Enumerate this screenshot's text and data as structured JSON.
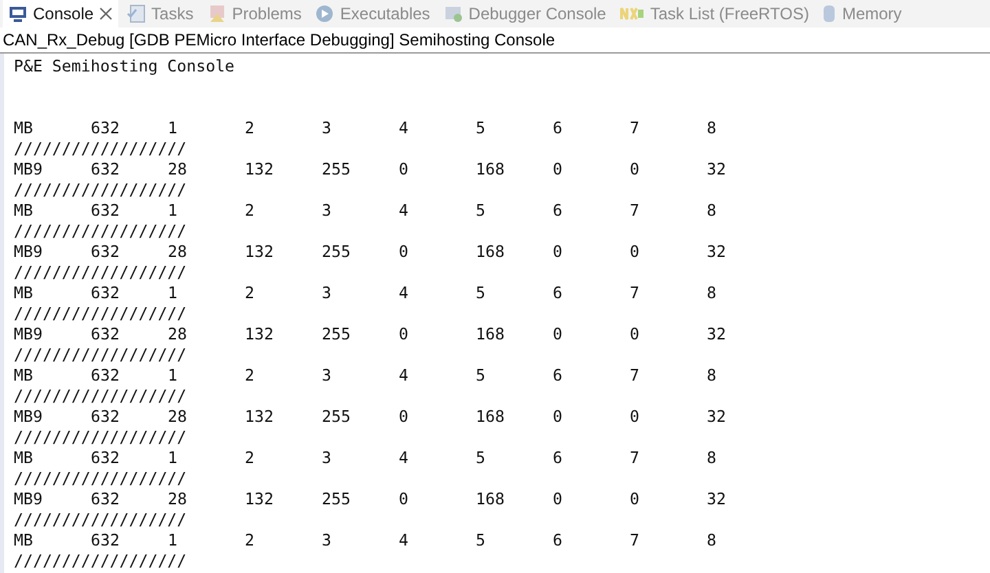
{
  "tabs": [
    {
      "label": "Console",
      "selected": true,
      "closable": true
    },
    {
      "label": "Tasks",
      "selected": false
    },
    {
      "label": "Problems",
      "selected": false
    },
    {
      "label": "Executables",
      "selected": false
    },
    {
      "label": "Debugger Console",
      "selected": false
    },
    {
      "label": "Task List (FreeRTOS)",
      "selected": false
    },
    {
      "label": "Memory",
      "selected": false
    }
  ],
  "console_title": "CAN_Rx_Debug [GDB PEMicro Interface Debugging] Semihosting Console",
  "console_header": "P&E Semihosting Console",
  "lines": [
    {
      "kind": "values",
      "cells": [
        "MB",
        "632",
        "1",
        "2",
        "3",
        "4",
        "5",
        "6",
        "7",
        "8"
      ]
    },
    {
      "kind": "separator",
      "text": "//////////////////"
    },
    {
      "kind": "values",
      "cells": [
        "MB9",
        "632",
        "28",
        "132",
        "255",
        "0",
        "168",
        "0",
        "0",
        "32"
      ]
    },
    {
      "kind": "separator",
      "text": "//////////////////"
    },
    {
      "kind": "values",
      "cells": [
        "MB",
        "632",
        "1",
        "2",
        "3",
        "4",
        "5",
        "6",
        "7",
        "8"
      ]
    },
    {
      "kind": "separator",
      "text": "//////////////////"
    },
    {
      "kind": "values",
      "cells": [
        "MB9",
        "632",
        "28",
        "132",
        "255",
        "0",
        "168",
        "0",
        "0",
        "32"
      ]
    },
    {
      "kind": "separator",
      "text": "//////////////////"
    },
    {
      "kind": "values",
      "cells": [
        "MB",
        "632",
        "1",
        "2",
        "3",
        "4",
        "5",
        "6",
        "7",
        "8"
      ]
    },
    {
      "kind": "separator",
      "text": "//////////////////"
    },
    {
      "kind": "values",
      "cells": [
        "MB9",
        "632",
        "28",
        "132",
        "255",
        "0",
        "168",
        "0",
        "0",
        "32"
      ]
    },
    {
      "kind": "separator",
      "text": "//////////////////"
    },
    {
      "kind": "values",
      "cells": [
        "MB",
        "632",
        "1",
        "2",
        "3",
        "4",
        "5",
        "6",
        "7",
        "8"
      ]
    },
    {
      "kind": "separator",
      "text": "//////////////////"
    },
    {
      "kind": "values",
      "cells": [
        "MB9",
        "632",
        "28",
        "132",
        "255",
        "0",
        "168",
        "0",
        "0",
        "32"
      ]
    },
    {
      "kind": "separator",
      "text": "//////////////////"
    },
    {
      "kind": "values",
      "cells": [
        "MB",
        "632",
        "1",
        "2",
        "3",
        "4",
        "5",
        "6",
        "7",
        "8"
      ]
    },
    {
      "kind": "separator",
      "text": "//////////////////"
    },
    {
      "kind": "values",
      "cells": [
        "MB9",
        "632",
        "28",
        "132",
        "255",
        "0",
        "168",
        "0",
        "0",
        "32"
      ]
    },
    {
      "kind": "separator",
      "text": "//////////////////"
    },
    {
      "kind": "values",
      "cells": [
        "MB",
        "632",
        "1",
        "2",
        "3",
        "4",
        "5",
        "6",
        "7",
        "8"
      ]
    },
    {
      "kind": "separator",
      "text": "//////////////////"
    }
  ]
}
